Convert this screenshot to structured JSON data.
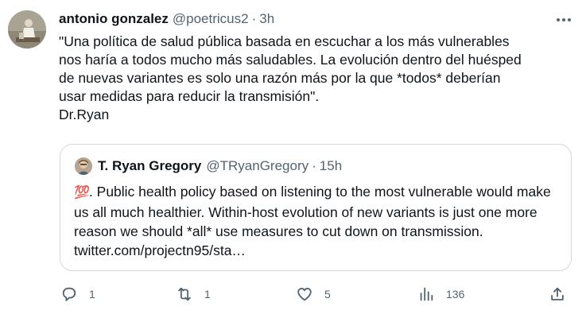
{
  "author": {
    "name": "antonio gonzalez",
    "handle": "@poetricus2",
    "separator": "·",
    "time": "3h"
  },
  "tweet_text": "\"Una política de salud pública basada en escuchar a los más vulnerables\nnos haría a todos mucho más saludables. La evolución dentro del huésped\nde nuevas variantes es solo una razón más por la que *todos* deberían\nusar medidas para reducir la transmisión\".\nDr.Ryan",
  "quoted": {
    "name": "T. Ryan Gregory",
    "handle": "@TRyanGregory",
    "separator": "·",
    "time": "15h",
    "emoji": "💯",
    "text": ". Public health policy based on listening to the most vulnerable would make us all much healthier. Within-host evolution of new variants is just one more reason we should *all* use measures to cut down on transmission. twitter.com/projectn95/sta…"
  },
  "actions": {
    "reply_count": "1",
    "retweet_count": "1",
    "like_count": "5",
    "views_count": "136"
  },
  "icons": {
    "more": "more-dots-icon",
    "reply": "reply-bubble-icon",
    "retweet": "retweet-icon",
    "like": "heart-icon",
    "views": "views-bar-chart-icon",
    "share": "share-upload-icon"
  },
  "colors": {
    "text": "#0f1419",
    "secondary": "#536471",
    "border": "#cfd9de"
  }
}
